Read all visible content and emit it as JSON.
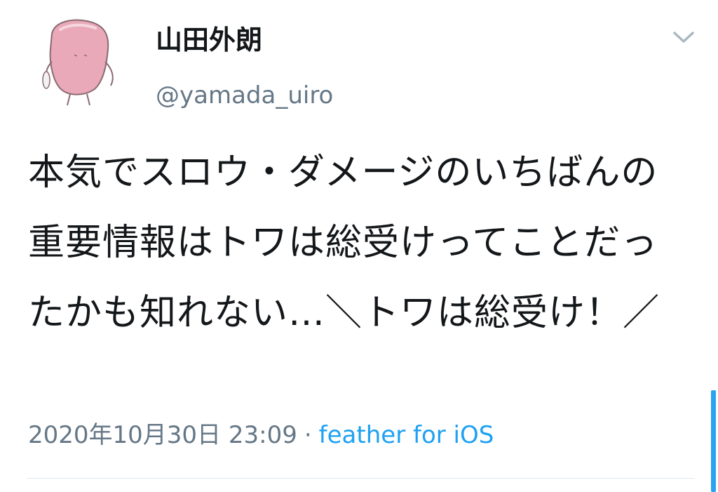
{
  "user": {
    "display_name": "山田外朗",
    "handle": "@yamada_uiro",
    "avatar_icon": "pink-blob-character-avatar"
  },
  "menu": {
    "icon": "chevron-down-icon"
  },
  "tweet": {
    "text": "本気でスロウ・ダメージのいちばんの重要情報はトワは総受けってことだったかも知れない…＼トワは総受け！／",
    "timestamp": "2020年10月30日 23:09",
    "separator": "·",
    "source": "feather for iOS"
  },
  "colors": {
    "text": "#14171a",
    "secondary": "#657786",
    "link": "#1da1f2",
    "divider": "#e1e8ed",
    "scrollbar": "#2aa3f0"
  }
}
